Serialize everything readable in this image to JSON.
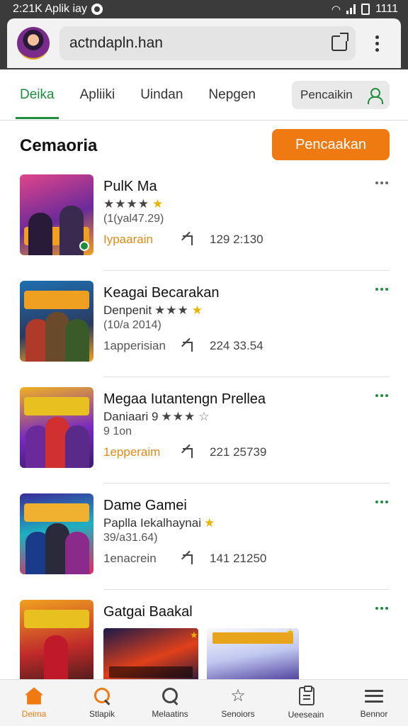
{
  "status_bar": {
    "time": "2:21K Aplik iay",
    "clock": "1111"
  },
  "header": {
    "search_text": "actndapln.han"
  },
  "tabs": [
    {
      "label": "Deika",
      "active": true
    },
    {
      "label": "Apliiki",
      "active": false
    },
    {
      "label": "Uindan",
      "active": false
    },
    {
      "label": "Nepgen",
      "active": false
    }
  ],
  "tab_search": {
    "label": "Pencaikin"
  },
  "section": {
    "title": "Cemaoria",
    "button_label": "Pencaakan"
  },
  "items": [
    {
      "title": "PulK Ma",
      "stars": "★★★★",
      "rating_extra": "",
      "meta": "(1(yal47.29)",
      "tag": "Iypaarain",
      "stat": "129 2:130",
      "colors": [
        "#6a2a9a",
        "#f0a020",
        "#d03040"
      ]
    },
    {
      "title": "Keagai Becarakan",
      "stars": "★★★",
      "rating_extra": "Denpenit",
      "meta": "(10/a 2014)",
      "tag": "1apperisian",
      "stat": "224 33.54",
      "colors": [
        "#1f6fb0",
        "#f0a020",
        "#2a3a60"
      ]
    },
    {
      "title": "Megaa Iutantengn Prellea",
      "stars": "★★★",
      "rating_extra": "Daniaari 9",
      "meta": "9 1on",
      "tag": "1epperaim",
      "stat": "221 25739",
      "colors": [
        "#f0b020",
        "#7a2ac0",
        "#e04040"
      ]
    },
    {
      "title": "Dame Gamei",
      "stars": "",
      "rating_extra": "Paplla Iekalhaynai",
      "meta": "39/a31.64)",
      "tag": "1enacrein",
      "stat": "141 21250",
      "colors": [
        "#3a2a9a",
        "#1fb0c0",
        "#e02a60"
      ]
    }
  ],
  "last_item": {
    "title": "Gatgai Baakal"
  },
  "bottom_nav": [
    {
      "label": "Deima",
      "icon": "home-icon",
      "active": true
    },
    {
      "label": "Stlapik",
      "icon": "search-icon",
      "active": false
    },
    {
      "label": "Melaatins",
      "icon": "search-icon",
      "active": false
    },
    {
      "label": "Senoiors",
      "icon": "star-icon",
      "active": false
    },
    {
      "label": "Ueeseain",
      "icon": "clipboard-icon",
      "active": false
    },
    {
      "label": "Bennor",
      "icon": "menu-icon",
      "active": false
    }
  ],
  "accent": {
    "green": "#1e8e3e",
    "orange": "#ef7a12"
  }
}
